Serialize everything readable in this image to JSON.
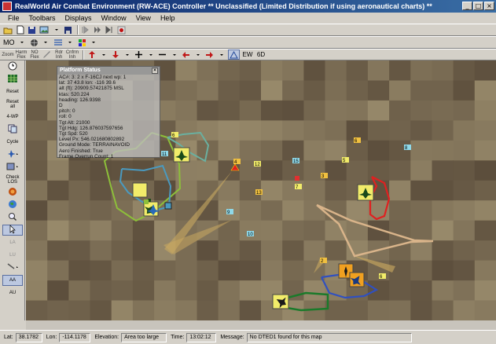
{
  "window": {
    "title": "RealWorld Air Combat Environment (RW-ACE) Controller     ** Unclassified (Limited Distribution if using aeronautical charts) **",
    "buttons": [
      "_",
      "□",
      "×"
    ]
  },
  "menu": [
    "File",
    "Toolbars",
    "Displays",
    "Window",
    "View",
    "Help"
  ],
  "toolbar2": {
    "mo_label": "MO"
  },
  "toolbar3": {
    "small_labels": [
      {
        "id": "zoom",
        "label": "Zoom"
      },
      {
        "id": "harm",
        "label": "Harm\nFlex"
      },
      {
        "id": "no-flex",
        "label": "NO\nFlex"
      },
      {
        "id": "rdr",
        "label": "Rdr\nInh"
      },
      {
        "id": "cnfrm",
        "label": "Cnfrm\nInh"
      }
    ],
    "ew_label": "EW",
    "sixd_label": "6D"
  },
  "sidebar": [
    {
      "id": "clock",
      "label": "",
      "icon": "clock-icon"
    },
    {
      "id": "aircraft-list",
      "label": "",
      "icon": "grid-icon"
    },
    {
      "id": "reset",
      "label": "Reset",
      "icon": ""
    },
    {
      "id": "reset-all",
      "label": "Reset\nall",
      "icon": ""
    },
    {
      "id": "4-wp",
      "label": "4-WP",
      "icon": ""
    },
    {
      "id": "copy",
      "label": "",
      "icon": "copy-icon"
    },
    {
      "id": "cycle",
      "label": "Cycle",
      "icon": ""
    },
    {
      "id": "aircraft-select",
      "label": "",
      "icon": "aircraft-icon"
    },
    {
      "id": "tool-select",
      "label": "",
      "icon": "tool-icon"
    },
    {
      "id": "check-los",
      "label": "Check\nLOS",
      "icon": ""
    },
    {
      "id": "target",
      "label": "",
      "icon": "target-icon"
    },
    {
      "id": "globe",
      "label": "",
      "icon": "globe-icon"
    },
    {
      "id": "zoom-tool",
      "label": "",
      "icon": "zoom-icon"
    },
    {
      "id": "pointer",
      "label": "",
      "icon": "pointer-icon",
      "pressed": true
    },
    {
      "id": "la",
      "label": "LA",
      "icon": "",
      "disabled": true
    },
    {
      "id": "lu",
      "label": "LU",
      "icon": "",
      "disabled": true
    },
    {
      "id": "arrow",
      "label": "",
      "icon": "arrow-icon"
    },
    {
      "id": "aa",
      "label": "AA",
      "icon": "",
      "pressed": true
    },
    {
      "id": "au",
      "label": "AU",
      "icon": ""
    }
  ],
  "platform_status": {
    "title": "Platform Status",
    "lines": [
      "AC#: 3: 2 x F-16CJ next wp: 1",
      "lat: 37 43.8  lon: -116 39.6",
      "alt (ft): 20909.57421875 MSL",
      "ktas: 520.224",
      "heading: 126.9398",
      "D",
      "pitch: 0",
      "roll: 0",
      "Tgt Alt: 21000",
      "Tgt Hdg: 126.876037597656",
      "Tgt Spd: 520",
      "Level Px: 546.021680802892",
      "Ground Mode: TERRAINAVOID",
      "Aero Finished: True",
      "Frame Overrun Count: 1"
    ]
  },
  "statusbar": {
    "lat_label": "Lat:",
    "lat": "38.1782",
    "lon_label": "Lon:",
    "lon": "-114.1178",
    "elev_label": "Elevation:",
    "elev": "Area too large",
    "time_label": "Time:",
    "time": "13:02:12",
    "msg_label": "Message:",
    "msg": "No DTED1 found for this map"
  },
  "map_labels": [
    {
      "id": "t1",
      "text": "6"
    },
    {
      "id": "t2",
      "text": "11"
    },
    {
      "id": "t3",
      "text": "4"
    },
    {
      "id": "t4",
      "text": "12"
    },
    {
      "id": "t5",
      "text": "15"
    },
    {
      "id": "t6",
      "text": "13"
    },
    {
      "id": "t7",
      "text": "7"
    },
    {
      "id": "t8",
      "text": "9"
    },
    {
      "id": "t9",
      "text": "3"
    },
    {
      "id": "t10",
      "text": "5"
    },
    {
      "id": "t11",
      "text": "8"
    },
    {
      "id": "t12",
      "text": "6"
    },
    {
      "id": "t13",
      "text": "6"
    },
    {
      "id": "t14",
      "text": "10"
    },
    {
      "id": "t15",
      "text": "2"
    }
  ],
  "colors": {
    "titlebar": "#0a246a",
    "terrain_dark": "#5e4e3a",
    "terrain_light": "#9a8a70",
    "route_green": "#8dbf3a",
    "route_blue": "#4a9ac0",
    "route_red": "#e02020",
    "route_tan": "#d9b48a",
    "route_navy": "#3050c0",
    "route_darkgreen": "#1a7a2a",
    "marker_yellow": "#f2ec6a",
    "marker_orange": "#f0a020"
  }
}
